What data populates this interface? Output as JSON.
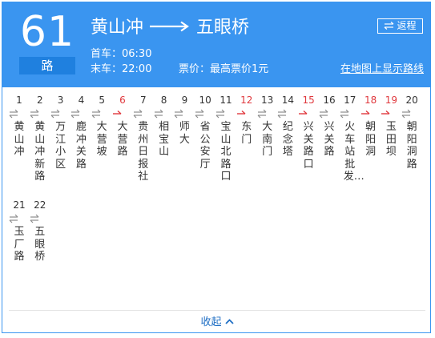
{
  "route": {
    "number": "61",
    "suffix": "路"
  },
  "title": {
    "from": "黄山冲",
    "to": "五眼桥"
  },
  "reverse_label": "返程",
  "first_bus": "首车：06:30",
  "last_bus": "末车：22:00",
  "fare": "票价：最高票价1元",
  "map_link": "在地图上显示路线",
  "collapse_label": "收起",
  "colors": {
    "header": "#3a95f0",
    "stop_red": "#e0393e",
    "link": "#1f6fc4"
  },
  "stops": [
    {
      "num": "1",
      "name": "黄山冲",
      "dir": "both"
    },
    {
      "num": "2",
      "name": "黄山冲新路",
      "dir": "both"
    },
    {
      "num": "3",
      "name": "万江小区",
      "dir": "both"
    },
    {
      "num": "4",
      "name": "鹿冲关路",
      "dir": "both"
    },
    {
      "num": "5",
      "name": "大营坡",
      "dir": "both"
    },
    {
      "num": "6",
      "name": "大营路",
      "dir": "one"
    },
    {
      "num": "7",
      "name": "贵州日报社",
      "dir": "both"
    },
    {
      "num": "8",
      "name": "相宝山",
      "dir": "both"
    },
    {
      "num": "9",
      "name": "师大",
      "dir": "both"
    },
    {
      "num": "10",
      "name": "省公安厅",
      "dir": "both"
    },
    {
      "num": "11",
      "name": "宝山北路口",
      "dir": "both"
    },
    {
      "num": "12",
      "name": "东门",
      "dir": "one"
    },
    {
      "num": "13",
      "name": "大南门",
      "dir": "both"
    },
    {
      "num": "14",
      "name": "纪念塔",
      "dir": "both"
    },
    {
      "num": "15",
      "name": "兴关路口",
      "dir": "one"
    },
    {
      "num": "16",
      "name": "兴关路",
      "dir": "both"
    },
    {
      "num": "17",
      "name": "火车站批发…",
      "dir": "both"
    },
    {
      "num": "18",
      "name": "朝阳洞",
      "dir": "one"
    },
    {
      "num": "19",
      "name": "玉田坝",
      "dir": "one"
    },
    {
      "num": "20",
      "name": "朝阳洞路",
      "dir": "both"
    },
    {
      "num": "21",
      "name": "玉厂路",
      "dir": "both"
    },
    {
      "num": "22",
      "name": "五眼桥",
      "dir": "both"
    }
  ]
}
